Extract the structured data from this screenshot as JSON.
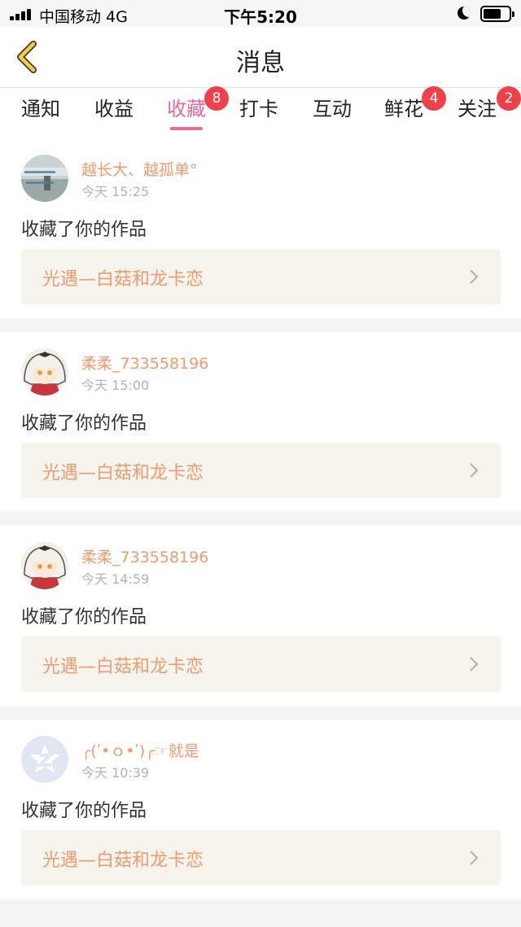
{
  "status_bar": {
    "carrier": "中国移动  4G",
    "time": "下午5:20",
    "icons": [
      "signal-icon",
      "moon-icon",
      "battery-icon"
    ]
  },
  "nav": {
    "title": "消息",
    "back_icon": "chevron-left-icon"
  },
  "tabs": [
    {
      "label": "通知"
    },
    {
      "label": "收益"
    },
    {
      "label": "收藏",
      "badge": "8",
      "active": true
    },
    {
      "label": "打卡"
    },
    {
      "label": "互动"
    },
    {
      "label": "鲜花",
      "badge": "4"
    },
    {
      "label": "关注",
      "badge": "2"
    }
  ],
  "colors": {
    "accent": "#e8689c",
    "badge": "#f0414a",
    "username": "#ef9b6f",
    "link_bg": "#f5f5ee"
  },
  "messages": [
    {
      "username": "越长大、越孤单°",
      "time": "今天 15:25",
      "action": "收藏了你的作品",
      "work": "光遇—白菇和龙卡恋",
      "avatar": "photo-avatar-icon"
    },
    {
      "username": "柔柔_733558196",
      "time": "今天 15:00",
      "action": "收藏了你的作品",
      "work": "光遇—白菇和龙卡恋",
      "avatar": "anime-girl-avatar-icon"
    },
    {
      "username": "柔柔_733558196",
      "time": "今天 14:59",
      "action": "收藏了你的作品",
      "work": "光遇—白菇和龙卡恋",
      "avatar": "anime-girl-avatar-icon"
    },
    {
      "username": "╭(ʹ•ｏ•ʹ)╭☞就是",
      "time": "今天 10:39",
      "action": "收藏了你的作品",
      "work": "光遇—白菇和龙卡恋",
      "avatar": "default-qq-avatar-icon"
    }
  ]
}
